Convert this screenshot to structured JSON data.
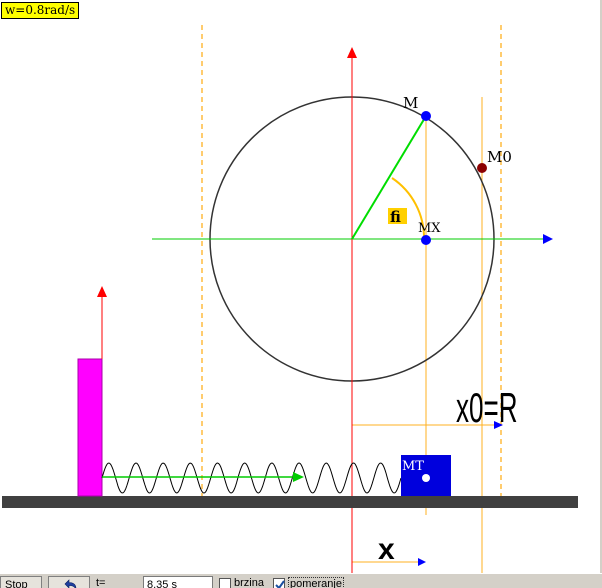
{
  "window": {
    "omega_label": "w=0.8rad/s"
  },
  "diagram": {
    "label_m": "M",
    "label_m0": "M0",
    "label_mx": "MX",
    "label_fi": "fi",
    "label_x0": "x0=R",
    "label_mt": "MT",
    "label_x": "x"
  },
  "colors": {
    "circle": "#333333",
    "axis": "#ff0000",
    "radius": "#00cc00",
    "guide": "#ffb020",
    "point": "#0000ff",
    "point_m0": "#8b0000",
    "block": "#0000dd",
    "wall": "#ff00ff",
    "ground": "#404040",
    "angle_label_bg": "#ffd000"
  },
  "controls": {
    "stop_label": "Stop",
    "back_icon": "undo-arrow-icon",
    "t_label": "t=",
    "time_value": "8.35 s",
    "brzina_label": "brzina",
    "brzina_checked": false,
    "pomeranje_label": "pomeranje",
    "pomeranje_checked": true
  }
}
